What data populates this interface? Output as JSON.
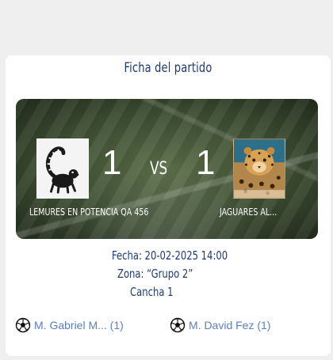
{
  "card": {
    "title": "Ficha del partido"
  },
  "match": {
    "home": {
      "name": "LEMURES EN POTENCIA QA 456",
      "score": "1",
      "crest_icon": "lemur-crest-icon"
    },
    "vs_label": "VS",
    "away": {
      "name": "JAGUARES AL...",
      "score": "1",
      "crest_icon": "jaguar-crest-icon"
    }
  },
  "details": {
    "fecha": "Fecha: 20-02-2025 14:00",
    "zona": "Zona: “Grupo 2”",
    "cancha": "Cancha 1"
  },
  "scorers": {
    "home": [
      {
        "icon": "soccer-ball-icon",
        "text": "M. Gabriel M... (1)"
      }
    ],
    "away": [
      {
        "icon": "soccer-ball-icon",
        "text": "M. David Fez (1)"
      }
    ]
  },
  "colors": {
    "title": "#1f3a73",
    "scorer_text": "#5a7fc0",
    "card_bg": "#ffffff",
    "page_bg": "#efefef"
  }
}
